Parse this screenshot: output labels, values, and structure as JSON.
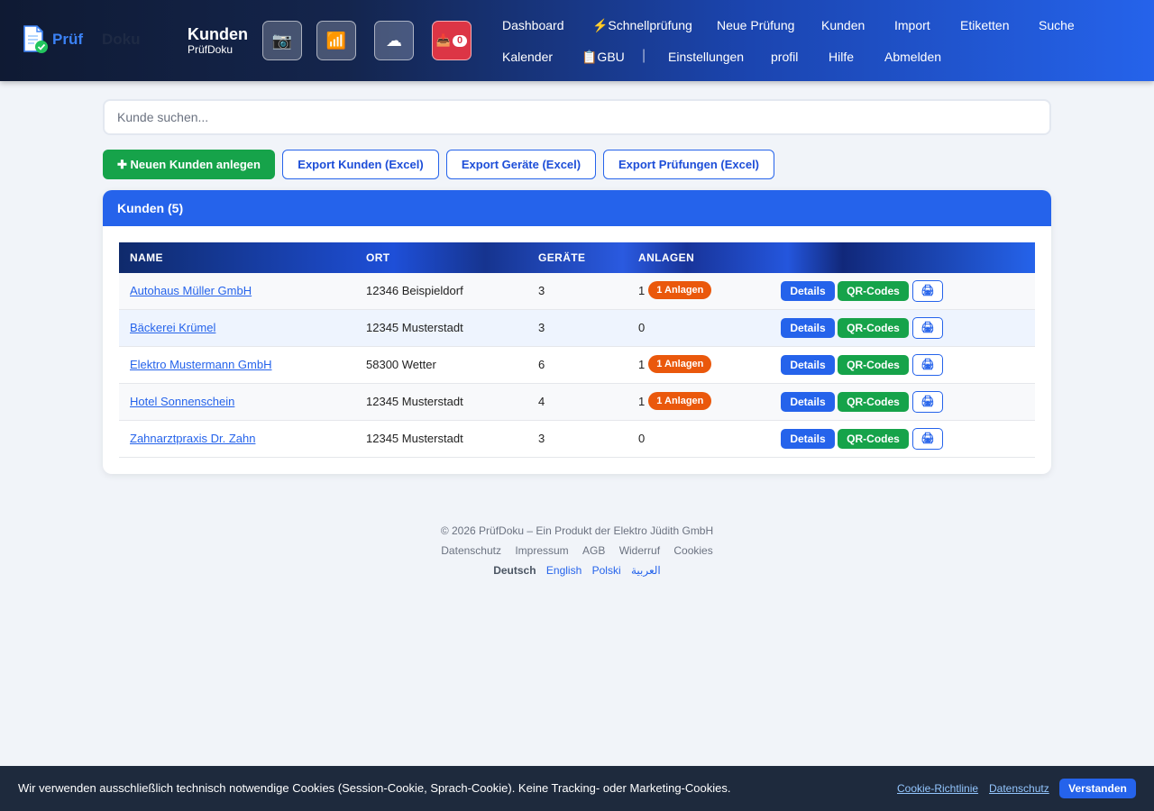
{
  "header": {
    "logo_part1": "Prüf",
    "logo_part2": "Doku",
    "page_title": "Kunden",
    "page_subtitle": "PrüfDoku",
    "quick_buttons": {
      "camera_icon": "📷",
      "signal_icon": "📶",
      "cloud_icon": "☁",
      "inbox_icon": "📥",
      "inbox_count": "0"
    },
    "nav_row1": [
      "Dashboard",
      "⚡Schnellprüfung",
      "Neue Prüfung",
      "Kunden",
      "Import",
      "Etiketten",
      "Suche"
    ],
    "nav_row2": [
      "Kalender",
      "📋GBU",
      "Einstellungen",
      "profil",
      "Hilfe",
      "Abmelden"
    ],
    "nav_separator": "|"
  },
  "search": {
    "placeholder": "Kunde suchen..."
  },
  "actions": {
    "new_customer": "✚ Neuen Kunden anlegen",
    "export_customers": "Export Kunden (Excel)",
    "export_devices": "Export Geräte (Excel)",
    "export_tests": "Export Prüfungen (Excel)"
  },
  "customers_card": {
    "title": "Kunden (5)",
    "columns": [
      "NAME",
      "ORT",
      "GERÄTE",
      "ANLAGEN"
    ],
    "rows": [
      {
        "name": "Autohaus Müller GmbH",
        "ort": "12346 Beispieldorf",
        "geraete": "3",
        "anlagen": "1",
        "badge": "1 Anlagen"
      },
      {
        "name": "Bäckerei Krümel",
        "ort": "12345 Musterstadt",
        "geraete": "3",
        "anlagen": "0",
        "badge": ""
      },
      {
        "name": "Elektro Mustermann GmbH",
        "ort": "58300 Wetter",
        "geraete": "6",
        "anlagen": "1",
        "badge": "1 Anlagen"
      },
      {
        "name": "Hotel Sonnenschein",
        "ort": "12345 Musterstadt",
        "geraete": "4",
        "anlagen": "1",
        "badge": "1 Anlagen"
      },
      {
        "name": "Zahnarztpraxis Dr. Zahn",
        "ort": "12345 Musterstadt",
        "geraete": "3",
        "anlagen": "0",
        "badge": ""
      }
    ],
    "row_actions": {
      "details": "Details",
      "qr": "QR-Codes",
      "print_icon": "🖨"
    }
  },
  "footer": {
    "copyright": "© 2026 PrüfDoku – Ein Produkt der Elektro Jüdith GmbH",
    "links": [
      "Datenschutz",
      "Impressum",
      "AGB",
      "Widerruf",
      "Cookies"
    ],
    "languages": [
      "Deutsch",
      "English",
      "Polski",
      "العربية"
    ],
    "current_language": "Deutsch"
  },
  "cookie_banner": {
    "message": "Wir verwenden ausschließlich technisch notwendige Cookies (Session-Cookie, Sprach-Cookie). Keine Tracking- oder Marketing-Cookies.",
    "policy_link": "Cookie-Richtlinie",
    "privacy_link": "Datenschutz",
    "accept": "Verstanden"
  },
  "colors": {
    "primary": "#2563eb",
    "success": "#16a34a",
    "badge_orange": "#ea580c",
    "danger": "#dc3545",
    "header_dark": "#0f1a33"
  }
}
